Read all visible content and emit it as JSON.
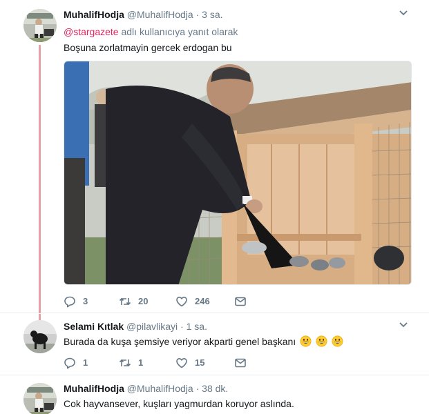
{
  "tweets": [
    {
      "name": "MuhalifHodja",
      "handle": "@MuhalifHodja",
      "time": "3 sa.",
      "reply_mention": "@stargazete",
      "reply_suffix": "adlı kullanıcıya yanıt olarak",
      "text": "Boşuna zorlatmayin gercek erdogan bu",
      "replies": "3",
      "retweets": "20",
      "likes": "246"
    },
    {
      "name": "Selami Kıtlak",
      "handle": "@pilavlikayi",
      "time": "1 sa.",
      "text": "Burada da kuşa şemsiye veriyor akparti genel başkanı",
      "emoji_count": 3,
      "replies": "1",
      "retweets": "1",
      "likes": "15"
    },
    {
      "name": "MuhalifHodja",
      "handle": "@MuhalifHodja",
      "time": "38 dk.",
      "text": "Cok hayvansever, kuşları yagmurdan koruyor aslında."
    }
  ],
  "separator": "·",
  "colors": {
    "thread_line": "#e8a0a8",
    "mention": "#e0245e",
    "muted": "#657786"
  }
}
